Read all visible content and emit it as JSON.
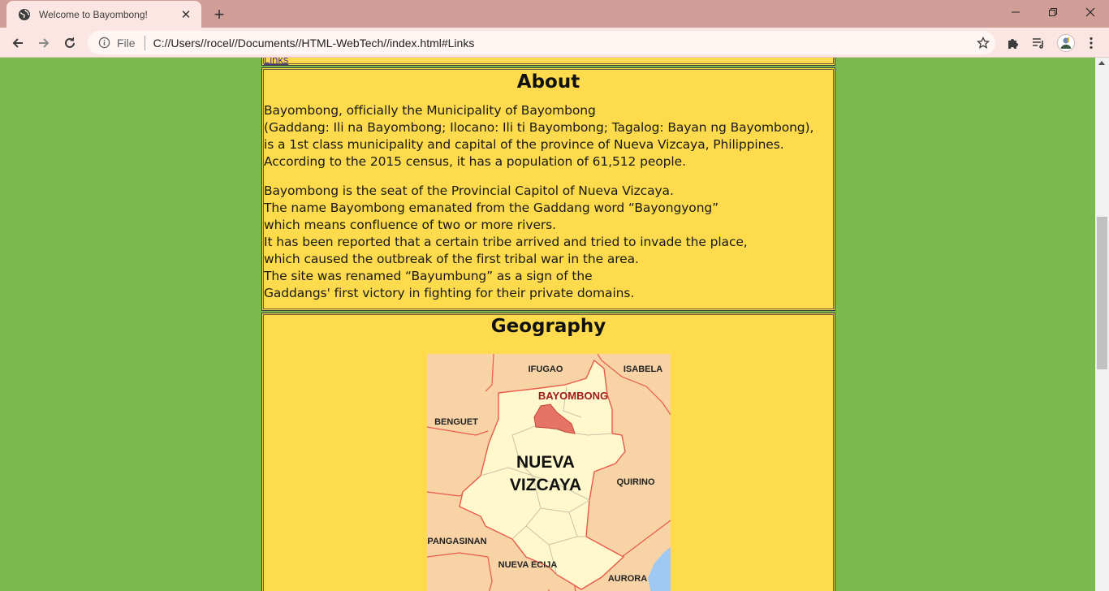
{
  "browser": {
    "tab_title": "Welcome to Bayombong!",
    "tab_close": "✕",
    "new_tab": "+",
    "scheme_label": "File",
    "url": "C://Users//rocel//Documents//HTML-WebTech//index.html#Links",
    "window_controls": {
      "minimize": "—",
      "restore": "❐",
      "close": "✕"
    }
  },
  "page": {
    "links_label": "Links",
    "about": {
      "heading": "About",
      "paragraph1": [
        "Bayombong, officially the Municipality of Bayombong",
        "(Gaddang: Ili na Bayombong; Ilocano: Ili ti Bayombong; Tagalog: Bayan ng Bayombong),",
        "is a 1st class municipality and capital of the province of Nueva Vizcaya, Philippines.",
        "According to the 2015 census, it has a population of 61,512 people."
      ],
      "paragraph2": [
        "Bayombong is the seat of the Provincial Capitol of Nueva Vizcaya.",
        "The name Bayombong emanated from the Gaddang word “Bayongyong”",
        "which means confluence of two or more rivers.",
        "It has been reported that a certain tribe arrived and tried to invade the place,",
        "which caused the outbreak of the first tribal war in the area.",
        "The site was renamed “Bayumbung” as a sign of the",
        "Gaddangs' first victory in fighting for their private domains."
      ]
    },
    "geography": {
      "heading": "Geography",
      "map_labels": {
        "ifugao": "IFUGAO",
        "isabela": "ISABELA",
        "bayombong": "BAYOMBONG",
        "benguet": "BENGUET",
        "nueva": "NUEVA",
        "vizcaya": "VIZCAYA",
        "quirino": "QUIRINO",
        "pangasinan": "PANGASINAN",
        "nueva_ecija": "NUEVA ECIJA",
        "aurora": "AURORA"
      }
    }
  },
  "colors": {
    "page_background": "#7aba4c",
    "content_background": "#fedb4c",
    "map_province": "#fff8cc",
    "map_neighbor": "#f7d3a6",
    "map_highlight": "#e57466",
    "map_water": "#9fc9f2"
  }
}
